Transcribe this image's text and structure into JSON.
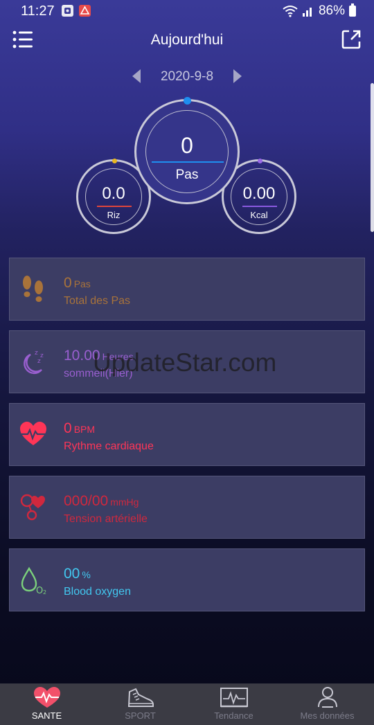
{
  "status_bar": {
    "time": "11:27",
    "battery": "86%"
  },
  "header": {
    "title": "Aujourd'hui"
  },
  "date_nav": {
    "date": "2020-9-8"
  },
  "rings": {
    "steps": {
      "value": "0",
      "label": "Pas",
      "accent": "#1e8ff0"
    },
    "distance": {
      "value": "0.0",
      "label": "Riz",
      "accent": "#e8b820",
      "line": "#e0463c"
    },
    "calories": {
      "value": "0.00",
      "label": "Kcal",
      "accent": "#9a6ae6",
      "line": "#8a5ae0"
    }
  },
  "cards": [
    {
      "value": "0",
      "unit": "Pas",
      "label": "Total des Pas",
      "color": "#a9733a",
      "icon": "footsteps-icon"
    },
    {
      "value": "10.00",
      "unit": "Heures",
      "label": "sommeil(Hier)",
      "color": "#9a5fd0",
      "icon": "sleep-moon-icon"
    },
    {
      "value": "0",
      "unit": "BPM",
      "label": "Rythme cardiaque",
      "color": "#ff3557",
      "icon": "heart-rate-icon"
    },
    {
      "value": "000/00",
      "unit": "mmHg",
      "label": "Tension artérielle",
      "color": "#d0283e",
      "icon": "blood-pressure-icon"
    },
    {
      "value": "00",
      "unit": "%",
      "label": "Blood oxygen",
      "color": "#42c8f0",
      "icon": "oxygen-drop-icon"
    }
  ],
  "watermark": "UpdateStar.com",
  "tabs": [
    {
      "label": "SANTE",
      "active": true,
      "icon": "heart-pulse-icon"
    },
    {
      "label": "SPORT",
      "active": false,
      "icon": "sneaker-icon"
    },
    {
      "label": "Tendance",
      "active": false,
      "icon": "trend-chart-icon"
    },
    {
      "label": "Mes données",
      "active": false,
      "icon": "user-profile-icon"
    }
  ]
}
